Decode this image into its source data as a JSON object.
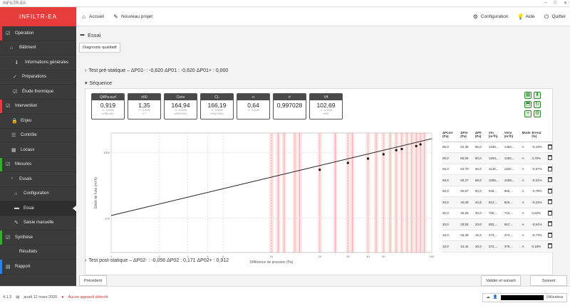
{
  "window": {
    "title": "INFILTR-EA"
  },
  "app": {
    "brand": "INFILTR-EA"
  },
  "topbar": {
    "home": "Accueil",
    "new_project": "Nouveau projet",
    "config": "Configuration",
    "help": "Aide",
    "quit": "Quitter"
  },
  "sidebar": {
    "items": [
      {
        "label": "Opération",
        "icon": "check-square-icon",
        "accent": "#e63c3c"
      },
      {
        "label": "Bâtiment",
        "icon": "home-icon"
      },
      {
        "label": "Informations générales",
        "icon": "info-icon"
      },
      {
        "label": "Préparations",
        "icon": "check-icon"
      },
      {
        "label": "Étude thermique",
        "icon": "check-square-icon"
      },
      {
        "label": "Intervention",
        "icon": "check-square-icon",
        "accent": "#e63c3c"
      },
      {
        "label": "Enjeu",
        "icon": "lock-icon"
      },
      {
        "label": "Contrôle",
        "icon": "list-icon"
      },
      {
        "label": "Locaux",
        "icon": "grid-icon"
      },
      {
        "label": "Mesures",
        "icon": "check-square-icon",
        "accent": "#3aaa35"
      },
      {
        "label": "Essais",
        "icon": "gauge-icon"
      },
      {
        "label": "Configuration",
        "icon": "home-icon"
      },
      {
        "label": "Essai",
        "icon": "chart-icon",
        "active": true
      },
      {
        "label": "Saisie manuelle",
        "icon": "edit-icon"
      },
      {
        "label": "Synthèse",
        "icon": "check-square-icon",
        "accent": "#3aaa35"
      },
      {
        "label": "Résultats",
        "icon": "none"
      },
      {
        "label": "Rapport",
        "icon": "file-icon",
        "accent": "#2f80ed"
      }
    ]
  },
  "page": {
    "title": "Essai",
    "diag_button": "Diagnostic qualitatif"
  },
  "sections": {
    "pre_test": "Test pré-statique – ΔP01- : -0,620   ΔP01 : -0,620   ΔP01+ : 0,000",
    "sequence": "Séquence",
    "post_test": "Test post-statique – ΔP02- : -0,056   ΔP02 : 0,171   ΔP02+ : 0,912"
  },
  "metrics": [
    {
      "head": "Q4Pa-surf",
      "value": "0,919",
      "sub1": "+/- 0,00%",
      "sub2": "m³/(h.m²)"
    },
    {
      "head": "n50",
      "value": "1,35",
      "sub1": "+/- 0,00%",
      "sub2": "h⁻¹"
    },
    {
      "head": "Cenv",
      "value": "164,94",
      "sub1": "+/- 0,00%",
      "sub2": "m³/(h.Paⁿ)"
    },
    {
      "head": "CL",
      "value": "166,19",
      "sub1": "+/- 0,00%",
      "sub2": "m³/(h.Paⁿ)"
    },
    {
      "head": "n",
      "value": "0,64",
      "sub1": "+/- 0,00%",
      "sub2": ""
    },
    {
      "head": "r²",
      "value": "0,997028",
      "sub1": "",
      "sub2": ""
    },
    {
      "head": "V4",
      "value": "102,69",
      "sub1": "+/- 0,00%",
      "sub2": "m³/h"
    }
  ],
  "table": {
    "headers": [
      "ΔPcorr (Pa)",
      "ΔPm (Pa)",
      "ΔP0 (Pa)",
      "Vm (m³/h)",
      "Venv (m³/h)",
      "Mode",
      "Erreur (%)",
      ""
    ],
    "rows": [
      [
        "85,0",
        "84,35",
        "85,0",
        "1340,...",
        "1363,...",
        "A",
        "-0,43%",
        ""
      ],
      [
        "80,0",
        "80,06",
        "80,0",
        "1263,...",
        "1282,...",
        "A",
        "3,75%",
        ""
      ],
      [
        "65,0",
        "64,70",
        "65,0",
        "1140,...",
        "1150,...",
        "A",
        "-0,57%",
        ""
      ],
      [
        "60,0",
        "60,37",
        "60,0",
        "1095,...",
        "1099,...",
        "A",
        "-0,31%",
        ""
      ],
      [
        "50,0",
        "50,57",
        "50,0",
        "949,...",
        "960,...",
        "A",
        "-0,78%",
        ""
      ],
      [
        "40,0",
        "40,08",
        "40,0",
        "813,...",
        "820,...",
        "A",
        "-0,22%",
        ""
      ],
      [
        "30,0",
        "30,65",
        "30,0",
        "700,...",
        "710,...",
        "A",
        "0,62%",
        ""
      ],
      [
        "20,0",
        "20,55",
        "20,0",
        "550,...",
        "557,...",
        "A",
        "-0,54%",
        ""
      ],
      [
        "15,0",
        "15,39",
        "15,0",
        "473,...",
        "474,...",
        "A",
        "-0,73%",
        ""
      ],
      [
        "10,0",
        "10,42",
        "10,0",
        "372,...",
        "378,...",
        "A",
        "0,18%",
        ""
      ]
    ]
  },
  "buttons": {
    "prev": "Précédent",
    "validate": "Valider et suivant",
    "next": "Suivant"
  },
  "status": {
    "version": "4.1.3",
    "date": "jeudi 12 mars 2020",
    "error": "Aucun appareil détecté",
    "user_label": "Utilisateur"
  },
  "chart_data": {
    "type": "scatter",
    "xlabel": "Différence de pression (Pa)",
    "ylabel": "Débit de fuite (m³/h)",
    "x_scale": "log",
    "y_scale": "log",
    "xlim": [
      1,
      100
    ],
    "ylim": [
      30,
      2000
    ],
    "x_ticks": [
      1,
      2,
      3,
      4,
      5,
      10,
      20,
      30,
      40,
      50,
      100
    ],
    "y_ticks": [
      100,
      1000
    ],
    "fit": {
      "name": "Régression",
      "x": [
        1,
        100
      ],
      "y": [
        110,
        1640
      ]
    },
    "points": {
      "x": [
        20,
        30,
        40,
        50,
        60,
        65,
        80,
        85
      ],
      "y": [
        550,
        700,
        813,
        949,
        1095,
        1140,
        1263,
        1340
      ]
    },
    "bands_x": [
      10,
      11,
      12,
      14,
      15,
      20,
      25,
      30,
      32,
      40,
      45,
      50,
      55,
      60,
      65,
      70,
      75,
      80,
      85,
      90
    ],
    "band_color": "#f26d6d",
    "grid": true
  }
}
